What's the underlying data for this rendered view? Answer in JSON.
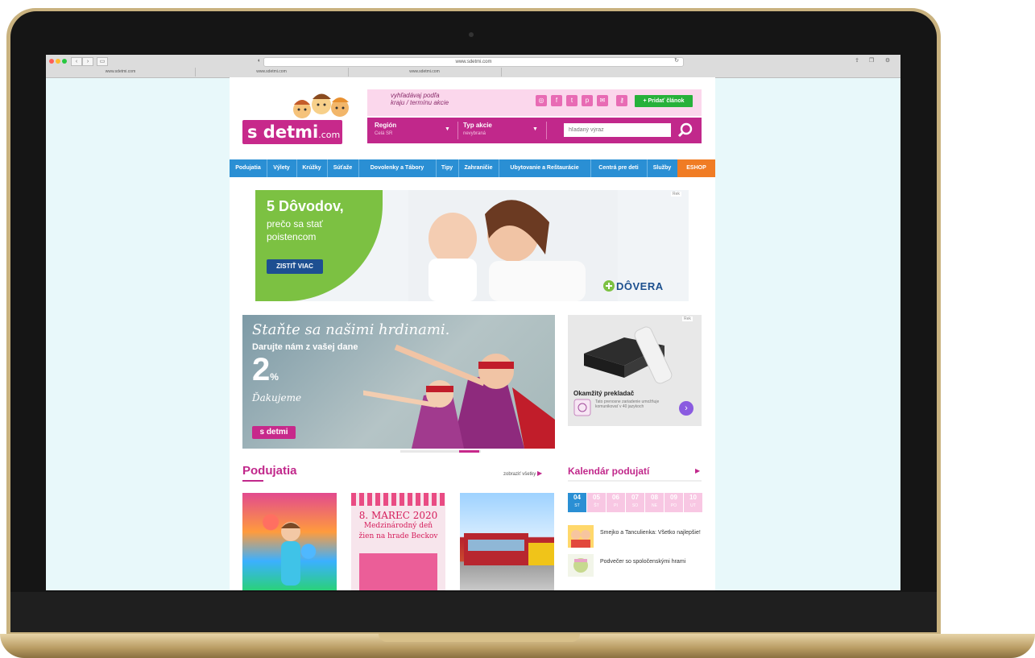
{
  "browser": {
    "url": "www.sdetmi.com",
    "tabs": [
      "www.sdetmi.com",
      "www.sdetmi.com",
      "www.sdetmi.com"
    ]
  },
  "header": {
    "logo_text": "s detmi",
    "logo_suffix": ".com",
    "search_hint_line1": "vyhľadávaj podľa",
    "search_hint_line2": "kraju / termínu akcie",
    "add_article": "+ Pridať článok",
    "region_label": "Región",
    "region_value": "Celá SR",
    "type_label": "Typ akcie",
    "type_value": "nevybraná",
    "search_placeholder": "hľadaný výraz",
    "social_icons": [
      "instagram-icon",
      "facebook-icon",
      "twitter-icon",
      "pinterest-icon",
      "mail-icon",
      "key-icon"
    ]
  },
  "menu": [
    "Podujatia",
    "Výlety",
    "Krúžky",
    "Súťaže",
    "Dovolenky a Tábory",
    "Tipy",
    "Zahraničie",
    "Ubytovanie a Reštaurácie",
    "Centrá pre deti",
    "Služby",
    "ESHOP"
  ],
  "ad_banner": {
    "title": "5 Dôvodov,",
    "subtitle_line1": "prečo sa stať",
    "subtitle_line2": "poistencom",
    "cta": "ZISTIŤ VIAC",
    "brand": "DÔVERA",
    "ad_mark": "Rek"
  },
  "hero": {
    "script": "Staňte sa našimi hrdinami.",
    "line": "Darujte nám z vašej dane",
    "number": "2",
    "percent": "%",
    "thanks": "Ďakujeme",
    "logo": "s detmi"
  },
  "side_ad": {
    "title": "Okamžitý prekladač",
    "desc": "Tato prenosne zariadenie umožňuje komunikovať v 40 jazykoch",
    "ad_mark": "Rek"
  },
  "events": {
    "title": "Podujatia",
    "show_all": "zobraziť všetky",
    "thumb2_line1": "8. MAREC 2020",
    "thumb2_line2": "Medzinárodný deň",
    "thumb2_line3": "žien na hrade Beckov"
  },
  "calendar": {
    "title": "Kalendár podujatí",
    "days": [
      {
        "num": "04",
        "dow": "ST"
      },
      {
        "num": "05",
        "dow": "ŠT"
      },
      {
        "num": "06",
        "dow": "PI"
      },
      {
        "num": "07",
        "dow": "SO"
      },
      {
        "num": "08",
        "dow": "NE"
      },
      {
        "num": "09",
        "dow": "PO"
      },
      {
        "num": "10",
        "dow": "UT"
      }
    ],
    "events": [
      "Smejko a Tanculienka: Všetko najlepšie!",
      "Podvečer so spoločenskými hrami"
    ]
  }
}
